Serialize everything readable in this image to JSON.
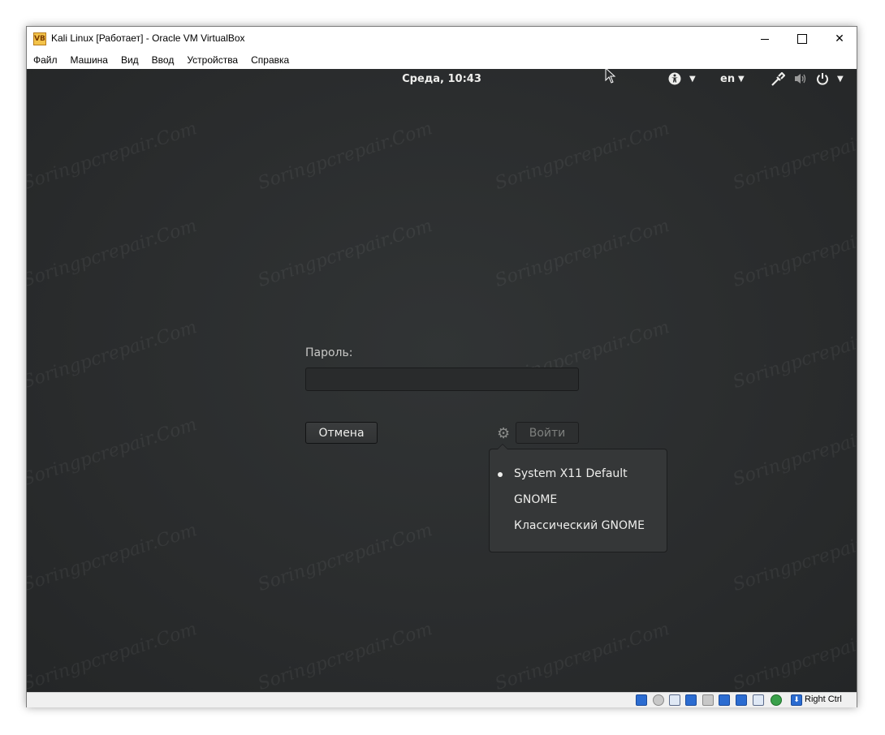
{
  "window": {
    "title": "Kali Linux [Работает] - Oracle VM VirtualBox",
    "minimize_glyph": "—",
    "close_glyph": "✕"
  },
  "menubar": {
    "items": [
      "Файл",
      "Машина",
      "Вид",
      "Ввод",
      "Устройства",
      "Справка"
    ]
  },
  "topbar": {
    "clock": "Среда, 10:43",
    "language": "en"
  },
  "login": {
    "password_label": "Пароль:",
    "password_value": "",
    "cancel_label": "Отмена",
    "login_label": "Войти"
  },
  "session_menu": {
    "items": [
      {
        "label": "System X11 Default",
        "selected": true
      },
      {
        "label": "GNOME",
        "selected": false
      },
      {
        "label": "Классический GNOME",
        "selected": false
      }
    ]
  },
  "statusbar": {
    "host_key": "Right Ctrl"
  },
  "watermark": "Soringpcrepair.Com",
  "colors": {
    "vm_background": "#2b2d2e",
    "panel_text": "#eeeeec",
    "menu_background": "#353738"
  }
}
